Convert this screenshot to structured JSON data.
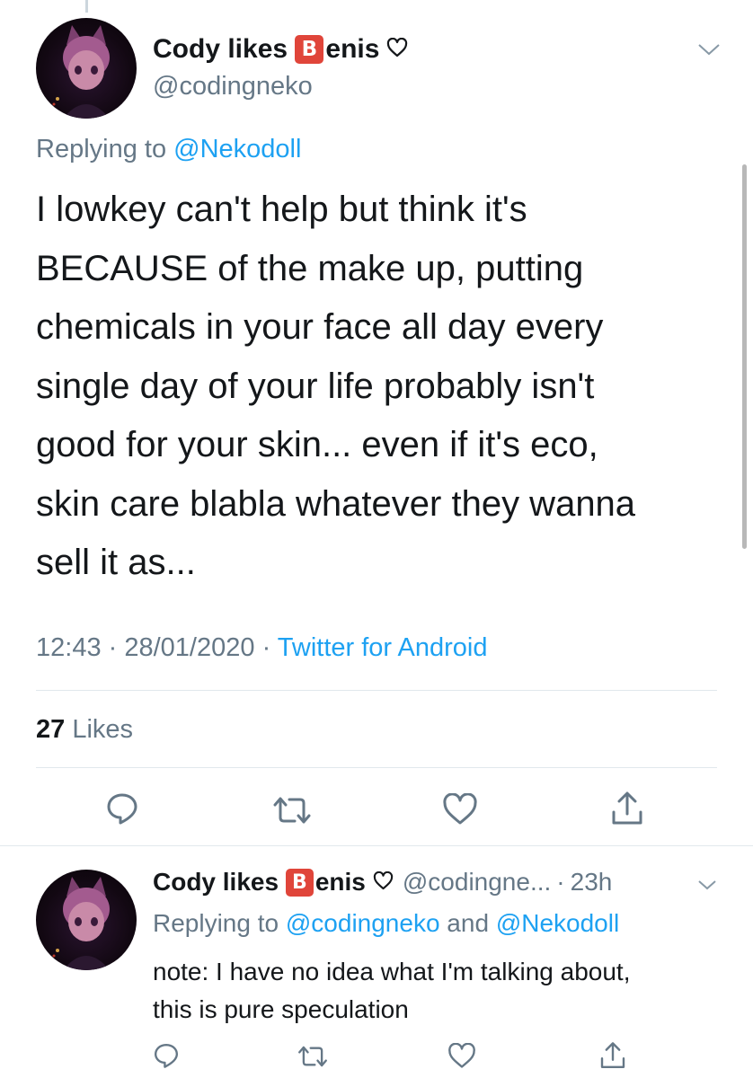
{
  "tweet": {
    "display_name_prefix": "Cody likes ",
    "emoji_letter": "B",
    "display_name_suffix": "enis",
    "handle": "@codingneko",
    "replying_prefix": "Replying to ",
    "replying_to": "@Nekodoll",
    "body_lines": [
      "I lowkey can't help but think it's",
      "BECAUSE of the make up, putting",
      "chemicals in your face all day every",
      "single day of your life probably isn't",
      "good for your skin... even if it's eco,",
      "skin care blabla whatever they wanna",
      "sell it as..."
    ],
    "time": "12:43",
    "sep": " · ",
    "date": "28/01/2020",
    "source": "Twitter for Android",
    "likes_count": "27",
    "likes_label": " Likes"
  },
  "reply": {
    "display_name_prefix": "Cody likes ",
    "emoji_letter": "B",
    "display_name_suffix": "enis",
    "handle_truncated": "@codingne...",
    "age": "23h",
    "replying_prefix": "Replying to ",
    "replying_to_1": "@codingneko",
    "replying_and": " and ",
    "replying_to_2": "@Nekodoll",
    "body_lines": [
      "note: I have no idea what I'm talking about,",
      "this is pure speculation"
    ]
  },
  "icons": {
    "reply": "comment-icon",
    "retweet": "retweet-icon",
    "like": "heart-icon",
    "share": "share-icon",
    "menu": "chevron-down-icon"
  },
  "colors": {
    "link": "#1da1f2",
    "secondary_text": "#657786",
    "primary_text": "#14171a",
    "emoji_bg": "#e0453a",
    "divider": "#e1e8ed"
  }
}
